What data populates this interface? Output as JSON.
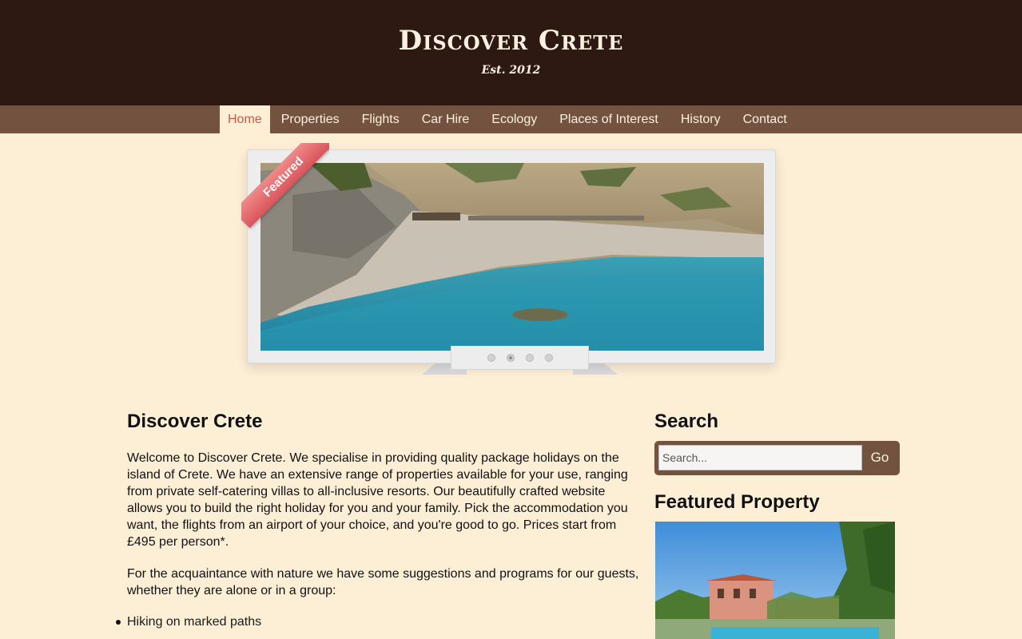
{
  "header": {
    "title": "Discover Crete",
    "tagline": "Est. 2012"
  },
  "nav": {
    "items": [
      {
        "label": "Home",
        "active": true
      },
      {
        "label": "Properties"
      },
      {
        "label": "Flights"
      },
      {
        "label": "Car Hire"
      },
      {
        "label": "Ecology"
      },
      {
        "label": "Places of Interest"
      },
      {
        "label": "History"
      },
      {
        "label": "Contact"
      }
    ]
  },
  "slider": {
    "ribbon_label": "Featured",
    "slide_count": 4,
    "active_slide": 2
  },
  "main": {
    "heading": "Discover Crete",
    "intro": "Welcome to Discover Crete. We specialise in providing quality package holidays on the island of Crete. We have an extensive range of properties available for your use, ranging from private self-catering villas to all-inclusive resorts. Our beautifully crafted website allows you to build the right holiday for you and your family. Pick the accommodation you want, the flights from an airport of your choice, and you're good to go. Prices start from £495 per person*.",
    "nature_intro": "For the acquaintance with nature we have some suggestions and programs for our guests, whether they are alone or in a group:",
    "activities": [
      "Hiking on marked paths"
    ]
  },
  "sidebar": {
    "search_heading": "Search",
    "search_placeholder": "Search...",
    "search_button": "Go",
    "featured_heading": "Featured Property"
  },
  "colors": {
    "header_bg": "#2e1912",
    "nav_bg": "#73533f",
    "page_bg": "#fdeed6",
    "active_link": "#c65a4a",
    "ribbon": "#d9545a"
  }
}
